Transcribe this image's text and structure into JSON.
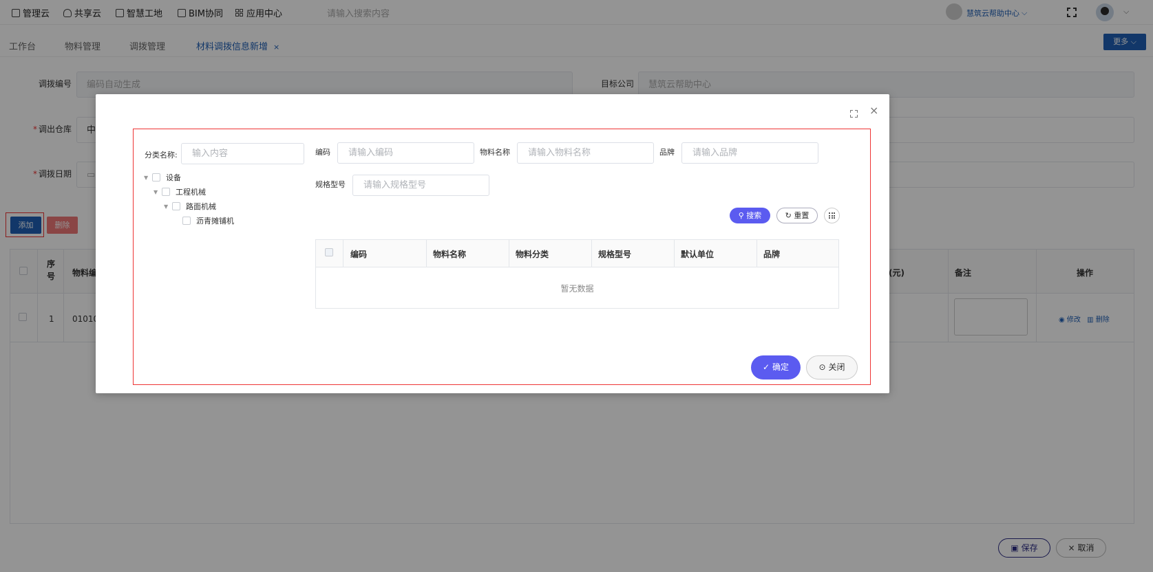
{
  "topnav": {
    "items": [
      {
        "label": "管理云",
        "icon": "book-icon"
      },
      {
        "label": "共享云",
        "icon": "cloud-icon"
      },
      {
        "label": "智慧工地",
        "icon": "book-icon"
      },
      {
        "label": "BIM协同",
        "icon": "folder-icon"
      },
      {
        "label": "应用中心",
        "icon": "grid-icon"
      }
    ],
    "search_placeholder": "请输入搜索内容",
    "org_name": "慧筑云帮助中心",
    "org_chevron": "⌵"
  },
  "tabs": {
    "items": [
      "工作台",
      "物料管理",
      "调拨管理",
      "材料调拨信息新增"
    ],
    "close": "×",
    "more_label": "更多"
  },
  "form": {
    "transfer_no_label": "调拨编号",
    "transfer_no_placeholder": "编码自动生成",
    "target_company_label": "目标公司",
    "target_company_value": "慧筑云帮助中心",
    "out_warehouse_label": "调出仓库",
    "out_warehouse_value": "中",
    "transfer_date_label": "调拨日期",
    "required_mark": "*"
  },
  "actions": {
    "add": "添加",
    "delete": "删除",
    "save": "保存",
    "cancel": "取消"
  },
  "bgtable": {
    "headers": [
      "序号",
      "物料编",
      "(元)",
      "备注",
      "操作"
    ],
    "row": {
      "index": "1",
      "code": "01010"
    },
    "ops": {
      "edit": "修改",
      "delete": "删除"
    }
  },
  "modal": {
    "category_label": "分类名称:",
    "category_placeholder": "输入内容",
    "code_label": "编码",
    "code_placeholder": "请输入编码",
    "name_label": "物料名称",
    "name_placeholder": "请输入物料名称",
    "brand_label": "品牌",
    "brand_placeholder": "请输入品牌",
    "spec_label": "规格型号",
    "spec_placeholder": "请输入规格型号",
    "tree": [
      "设备",
      "工程机械",
      "路面机械",
      "沥青摊铺机"
    ],
    "search": "搜索",
    "reset": "重置",
    "table_headers": [
      "编码",
      "物料名称",
      "物料分类",
      "规格型号",
      "默认单位",
      "品牌"
    ],
    "empty_text": "暂无数据",
    "ok": "确定",
    "close": "关闭"
  },
  "colors": {
    "primary": "#1f5fb5",
    "accent": "#5b5bf0",
    "danger": "#e33333"
  }
}
